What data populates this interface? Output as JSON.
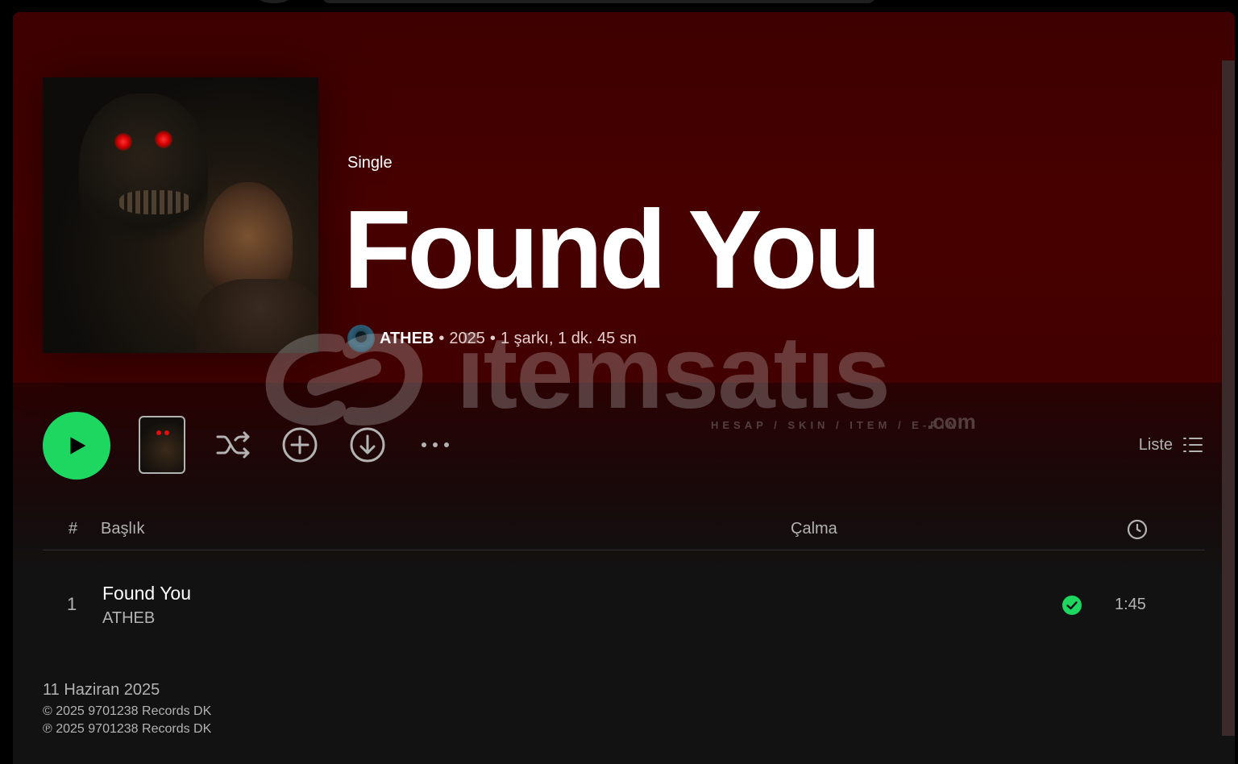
{
  "album": {
    "type_label": "Single",
    "title": "Found You",
    "artist": "ATHEB",
    "year": "2025",
    "summary": "1 şarkı, 1 dk. 45 sn",
    "separator": "•"
  },
  "controls": {
    "play_icon": "play-icon",
    "shuffle_icon": "shuffle-icon",
    "add_icon": "add-circle-icon",
    "download_icon": "download-icon",
    "more_icon": "more-horizontal-icon",
    "view_label": "Liste",
    "view_icon": "list-icon"
  },
  "table": {
    "headers": {
      "number": "#",
      "title": "Başlık",
      "plays": "Çalma",
      "duration_icon": "clock-icon"
    },
    "tracks": [
      {
        "number": "1",
        "title": "Found You",
        "artist": "ATHEB",
        "plays": "",
        "saved": true,
        "duration": "1:45"
      }
    ]
  },
  "footer": {
    "release_date": "11 Haziran 2025",
    "copyright": "© 2025 9701238 Records DK",
    "phonogram": "℗ 2025 9701238 Records DK"
  },
  "watermark": {
    "brand": "itemsatıs",
    "tagline": "HESAP / SKIN / ITEM / E-PIN",
    "suffix": ".com"
  },
  "colors": {
    "accent_green": "#1ed760",
    "hero_red": "#470000",
    "background": "#121212"
  }
}
